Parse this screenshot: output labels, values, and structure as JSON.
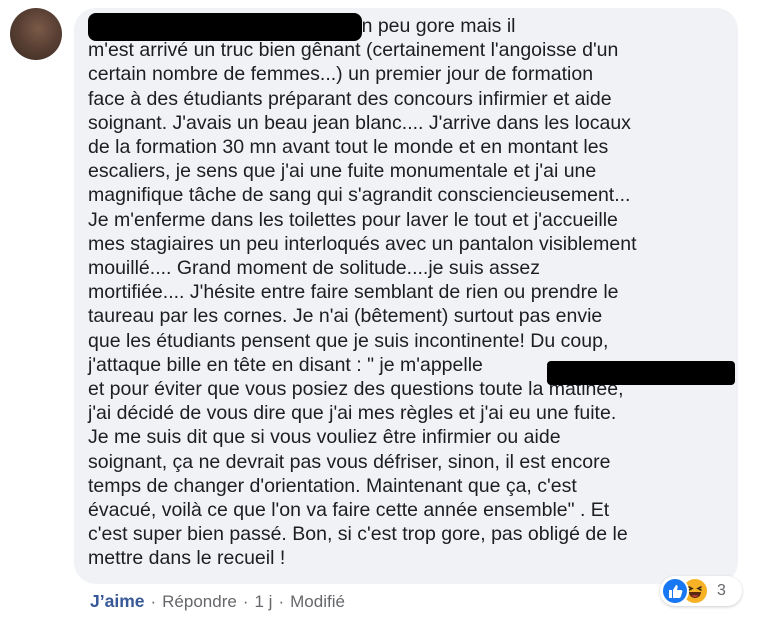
{
  "comment": {
    "text": "                         Bon, moi c'est un peu gore mais il\nm'est arrivé un truc bien gênant (certainement l'angoisse d'un\ncertain nombre de femmes...) un premier jour de formation\nface à des étudiants préparant des concours infirmier et aide\nsoignant. J'avais un beau jean blanc.... J'arrive dans les locaux\nde la formation 30 mn avant tout le monde et en montant les\nescaliers, je sens que j'ai une fuite monumentale et j'ai une\nmagnifique tâche de sang qui s'agrandit consciencieusement...\nJe m'enferme dans les toilettes pour laver le tout et j'accueille\nmes stagiaires un peu interloqués avec un pantalon visiblement\nmouillé.... Grand moment de solitude....je suis assez\nmortifiée.... J'hésite entre faire semblant de rien ou prendre le\ntaureau par les cornes. Je n'ai (bêtement) surtout pas envie\nque les étudiants pensent que je suis incontinente! Du coup,\nj'attaque bille en tête en disant : \" je m'appelle\net pour éviter que vous posiez des questions toute la matinée,\nj'ai décidé de vous dire que j'ai mes règles et j'ai eu une fuite.\nJe me suis dit que si vous vouliez être infirmier ou aide\nsoignant, ça ne devrait pas vous défriser, sinon, il est encore\ntemps de changer d'orientation. Maintenant que ça, c'est\névacué, voilà ce que l'on va faire cette année ensemble\" . Et\nc'est super bien passé. Bon, si c'est trop gore, pas obligé de le\nmettre dans le recueil !"
  },
  "actions": {
    "like_label": "J’aime",
    "reply_label": "Répondre",
    "time_label": "1 j",
    "edited_label": "Modifié",
    "separator": "·"
  },
  "reactions": {
    "count": "3",
    "icons": [
      "like-icon",
      "haha-icon"
    ]
  },
  "colors": {
    "bubble_bg": "#f0f2f5",
    "text": "#1c1e21",
    "meta": "#65676b",
    "like_link": "#385898",
    "like_reaction": "#1877f2",
    "haha_reaction": "#f7b125"
  }
}
